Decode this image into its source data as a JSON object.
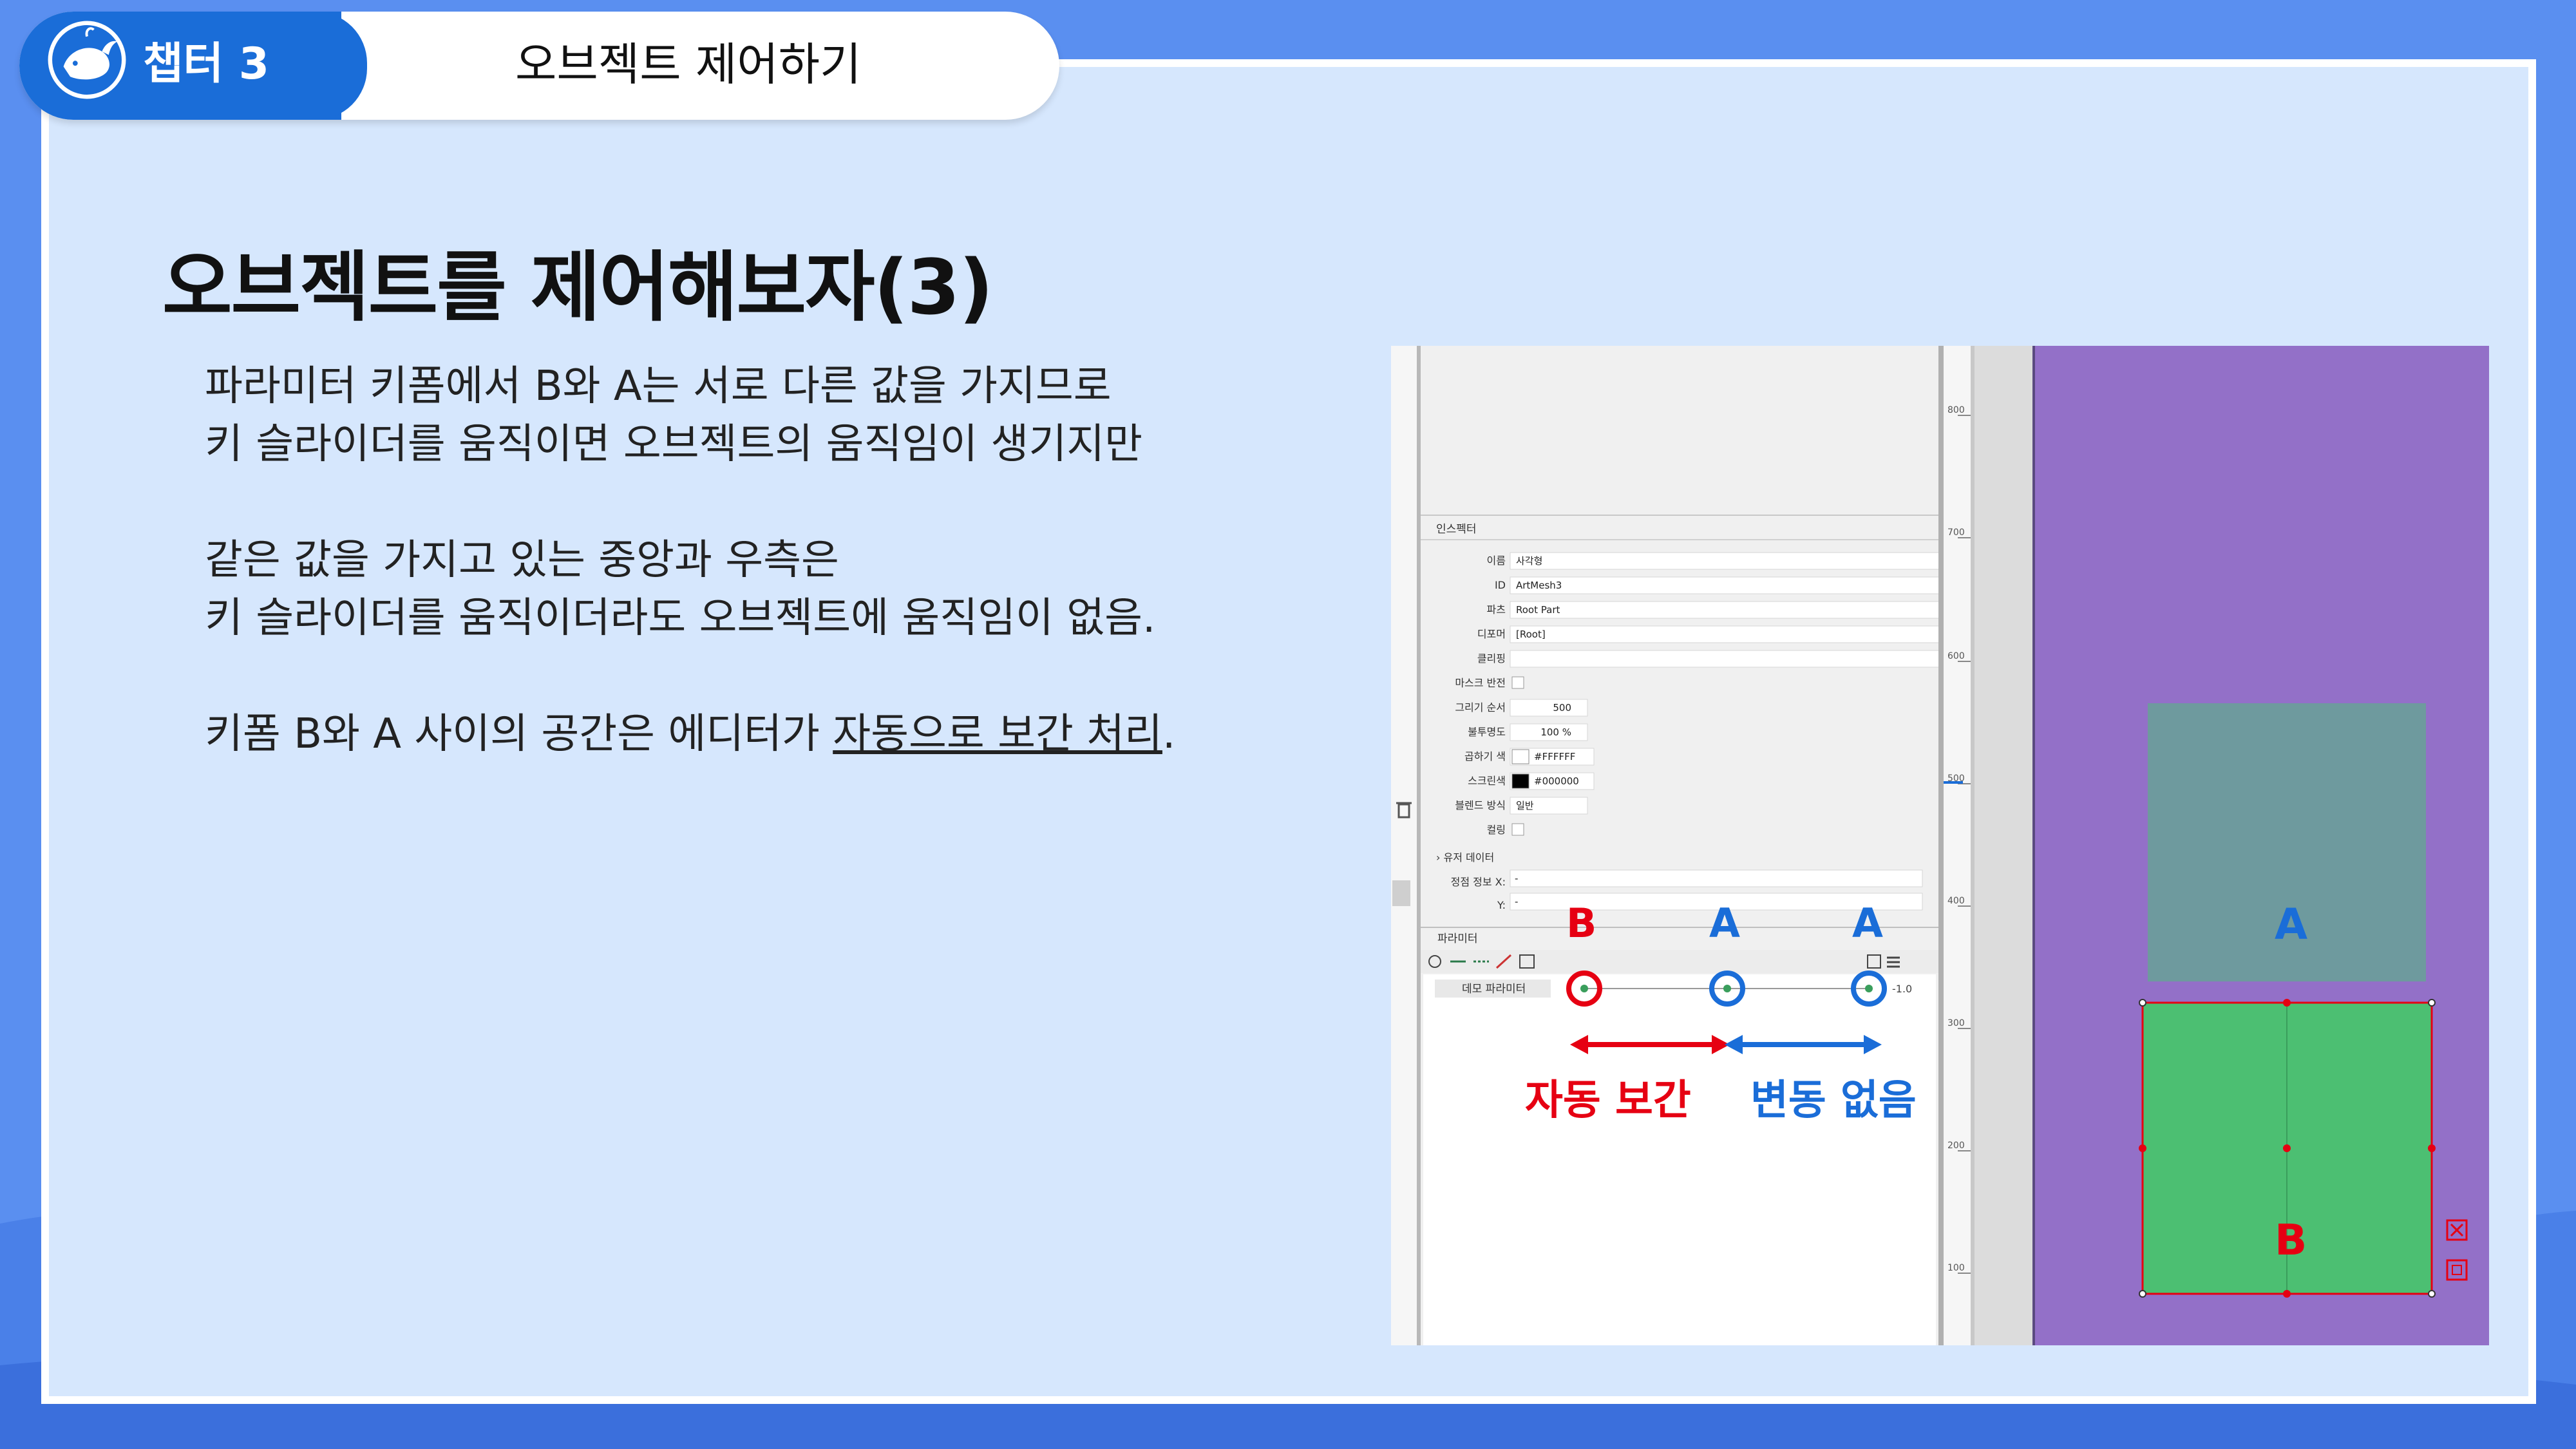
{
  "header": {
    "chapter": "챕터 3",
    "title": "오브젝트 제어하기"
  },
  "slide": {
    "heading": "오브젝트를 제어해보자(3)",
    "paragraphs": [
      "파라미터 키폼에서 B와 A는 서로 다른 값을 가지므로",
      "키 슬라이더를 움직이면 오브젝트의 움직임이 생기지만",
      "같은 값을 가지고 있는 중앙과 우측은",
      "키 슬라이더를 움직이더라도 오브젝트에 움직임이 없음."
    ],
    "last_line_prefix": "키폼 B와 A 사이의 공간은 에디터가 ",
    "last_line_underlined": "자동으로 보간 처리",
    "last_line_suffix": "."
  },
  "inspector": {
    "title": "인스펙터",
    "fields": [
      {
        "label": "이름",
        "value": "사각형"
      },
      {
        "label": "ID",
        "value": "ArtMesh3"
      },
      {
        "label": "파츠",
        "value": "Root Part"
      },
      {
        "label": "디포머",
        "value": "[Root]"
      },
      {
        "label": "클리핑",
        "value": ""
      },
      {
        "label": "마스크 반전",
        "value": ""
      },
      {
        "label": "그리기 순서",
        "value": "500"
      },
      {
        "label": "불투명도",
        "value": "100 %"
      },
      {
        "label": "곱하기 색",
        "value": "#FFFFFF"
      },
      {
        "label": "스크린색",
        "value": "#000000"
      },
      {
        "label": "블렌드 방식",
        "value": "일반"
      },
      {
        "label": "컬링",
        "value": ""
      }
    ],
    "user_data": "유저 데이터",
    "vertex_info": "정점 정보",
    "x_label": "X:",
    "y_label": "Y:",
    "x_value": "-",
    "y_value": "-"
  },
  "parameter_panel": {
    "title": "파라미터",
    "param_name": "데모 파라미터",
    "max_value": "-1.0"
  },
  "ruler": {
    "ticks": [
      "800",
      "700",
      "600",
      "500",
      "400",
      "300",
      "200",
      "100"
    ]
  },
  "annotations": {
    "key_b": "B",
    "key_a1": "A",
    "key_a2": "A",
    "auto_interp": "자동 보간",
    "no_change": "변동 없음",
    "canvas_a": "A",
    "canvas_b": "B"
  },
  "colors": {
    "accent_blue": "#1a6dd8",
    "red": "#e60012",
    "canvas_purple": "#9370c8",
    "mesh_green": "#4cbf72",
    "mesh_gray": "#6e9a9e"
  }
}
